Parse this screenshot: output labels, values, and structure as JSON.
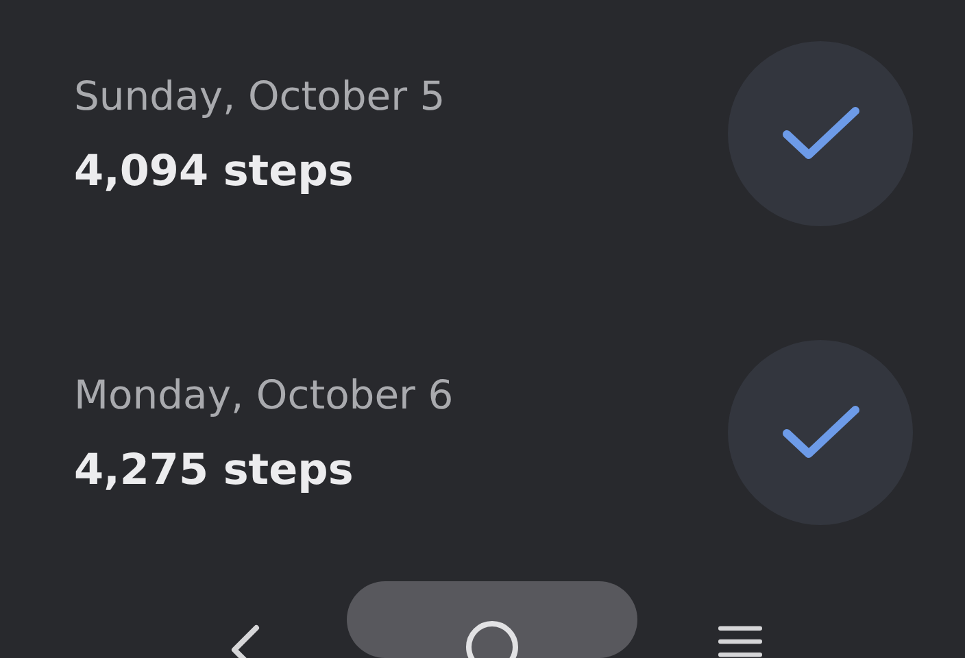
{
  "days": [
    {
      "date": "Sunday, October 5",
      "steps": "4,094 steps",
      "completed": true
    },
    {
      "date": "Monday, October 6",
      "steps": "4,275 steps",
      "completed": true
    }
  ]
}
